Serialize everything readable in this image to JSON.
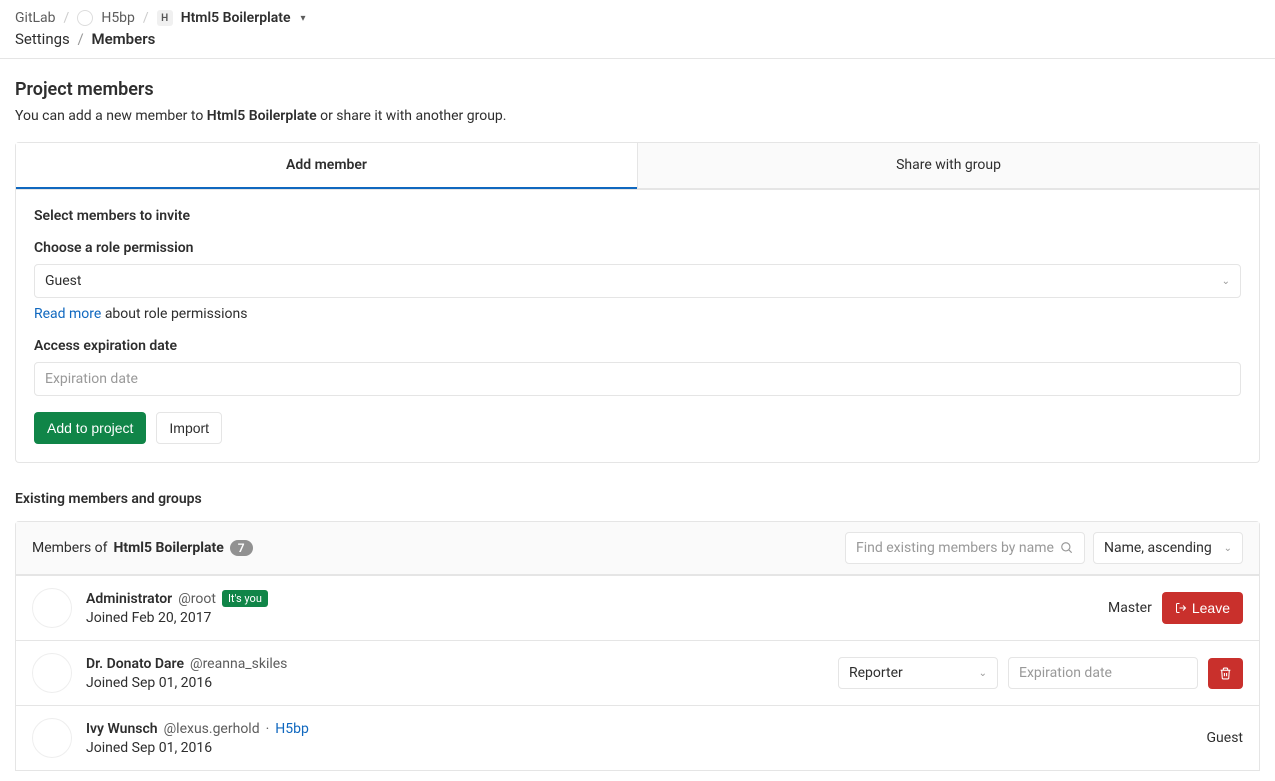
{
  "breadcrumbs": {
    "root": "GitLab",
    "group": "H5bp",
    "project_initial": "H",
    "project": "Html5 Boilerplate"
  },
  "subcrumbs": {
    "settings": "Settings",
    "members": "Members"
  },
  "header": {
    "title": "Project members",
    "subtitle_pre": "You can add a new member to ",
    "subtitle_project": "Html5 Boilerplate",
    "subtitle_post": " or share it with another group."
  },
  "tabs": {
    "add": "Add member",
    "share": "Share with group"
  },
  "form": {
    "select_label": "Select members to invite",
    "role_label": "Choose a role permission",
    "role_value": "Guest",
    "hint_link": "Read more",
    "hint_rest": " about role permissions",
    "exp_label": "Access expiration date",
    "exp_placeholder": "Expiration date",
    "add_btn": "Add to project",
    "import_btn": "Import"
  },
  "existing": {
    "heading": "Existing members and groups",
    "members_of_pre": "Members of ",
    "members_of_project": "Html5 Boilerplate",
    "count": "7",
    "search_placeholder": "Find existing members by name",
    "sort_value": "Name, ascending"
  },
  "members": [
    {
      "name": "Administrator",
      "handle": "@root",
      "you": "It's you",
      "joined": "Joined Feb 20, 2017",
      "role": "Master",
      "leave": "Leave",
      "editable": false,
      "is_you": true
    },
    {
      "name": "Dr. Donato Dare",
      "handle": "@reanna_skiles",
      "joined": "Joined Sep 01, 2016",
      "role": "Reporter",
      "exp_placeholder": "Expiration date",
      "editable": true,
      "is_you": false
    },
    {
      "name": "Ivy Wunsch",
      "handle": "@lexus.gerhold",
      "via": " · ",
      "via_link": "H5bp",
      "joined": "Joined Sep 01, 2016",
      "role": "Guest",
      "editable": false,
      "is_you": false
    }
  ]
}
